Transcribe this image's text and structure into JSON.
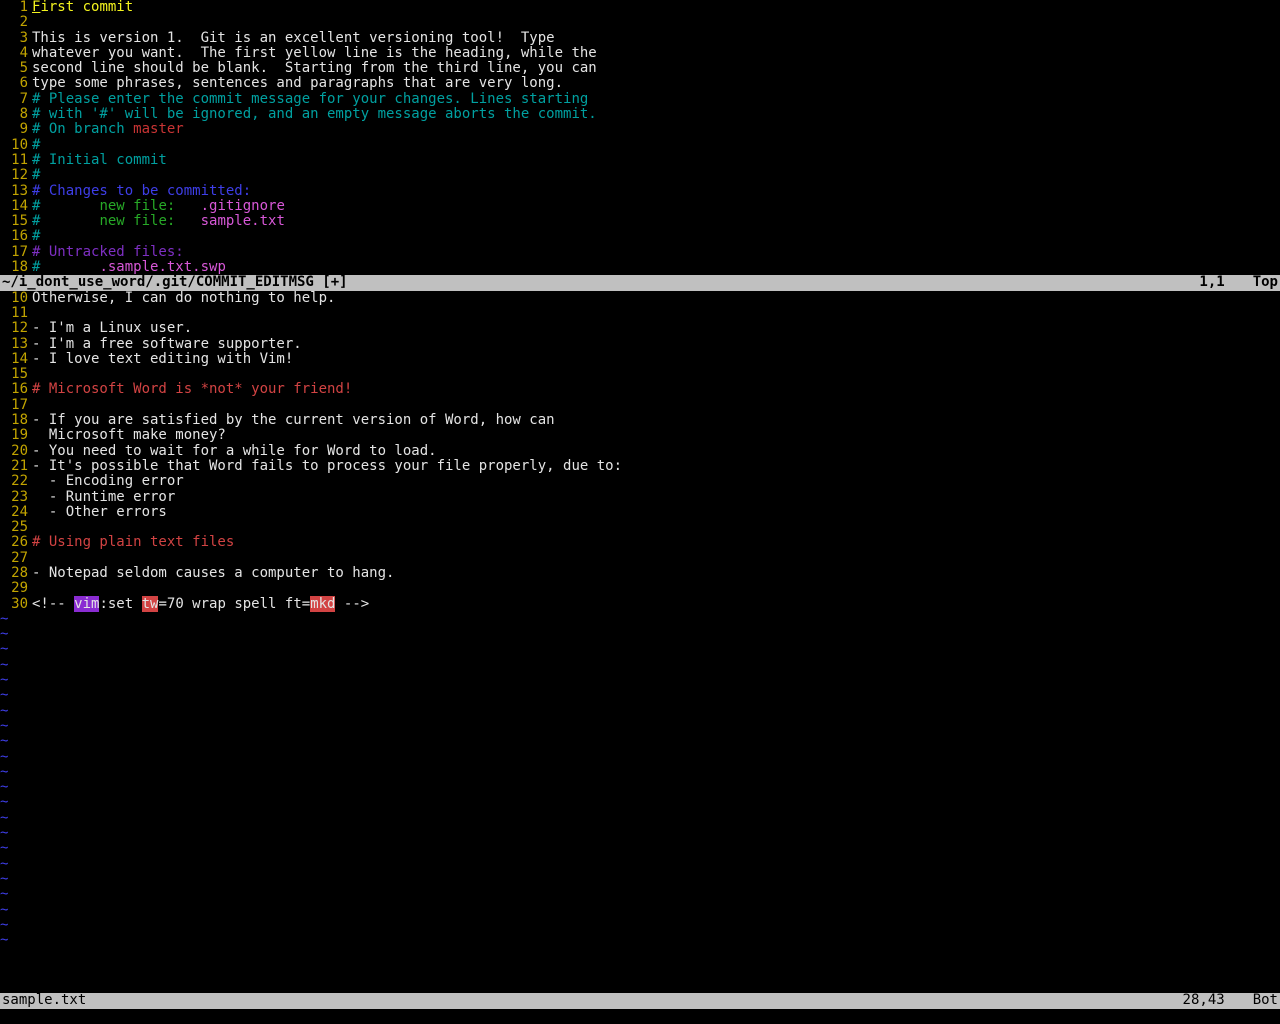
{
  "top_lines": [
    {
      "n": 1,
      "spans": [
        {
          "cls": "c-yellow cursor",
          "t": "F"
        },
        {
          "cls": "c-yellow",
          "t": "irst commit"
        }
      ]
    },
    {
      "n": 2,
      "spans": []
    },
    {
      "n": 3,
      "spans": [
        {
          "cls": "c-white",
          "t": "This is version 1.  Git is an excellent versioning tool!  Type"
        }
      ]
    },
    {
      "n": 4,
      "spans": [
        {
          "cls": "c-white",
          "t": "whatever you want.  The first yellow line is the heading, while the"
        }
      ]
    },
    {
      "n": 5,
      "spans": [
        {
          "cls": "c-white",
          "t": "second line should be blank.  Starting from the third line, you can"
        }
      ]
    },
    {
      "n": 6,
      "spans": [
        {
          "cls": "c-white",
          "t": "type some phrases, sentences and paragraphs that are very long."
        }
      ]
    },
    {
      "n": 7,
      "spans": [
        {
          "cls": "c-cyan",
          "t": "# Please enter the commit message for your changes. Lines starting"
        }
      ]
    },
    {
      "n": 8,
      "spans": [
        {
          "cls": "c-cyan",
          "t": "# with '#' will be ignored, and an empty message aborts the commit."
        }
      ]
    },
    {
      "n": 9,
      "spans": [
        {
          "cls": "c-cyan",
          "t": "# On branch "
        },
        {
          "cls": "c-red",
          "t": "master"
        }
      ]
    },
    {
      "n": 10,
      "spans": [
        {
          "cls": "c-cyan",
          "t": "#"
        }
      ]
    },
    {
      "n": 11,
      "spans": [
        {
          "cls": "c-cyan",
          "t": "# Initial commit"
        }
      ]
    },
    {
      "n": 12,
      "spans": [
        {
          "cls": "c-cyan",
          "t": "#"
        }
      ]
    },
    {
      "n": 13,
      "spans": [
        {
          "cls": "c-blue",
          "t": "# Changes to be committed:"
        }
      ]
    },
    {
      "n": 14,
      "spans": [
        {
          "cls": "c-cyan",
          "t": "#       "
        },
        {
          "cls": "c-green",
          "t": "new file:   "
        },
        {
          "cls": "c-magenta",
          "t": ".gitignore"
        }
      ]
    },
    {
      "n": 15,
      "spans": [
        {
          "cls": "c-cyan",
          "t": "#       "
        },
        {
          "cls": "c-green",
          "t": "new file:   "
        },
        {
          "cls": "c-magenta",
          "t": "sample.txt"
        }
      ]
    },
    {
      "n": 16,
      "spans": [
        {
          "cls": "c-cyan",
          "t": "#"
        }
      ]
    },
    {
      "n": 17,
      "spans": [
        {
          "cls": "c-purple",
          "t": "# Untracked files:"
        }
      ]
    },
    {
      "n": 18,
      "spans": [
        {
          "cls": "c-cyan",
          "t": "#       "
        },
        {
          "cls": "c-magenta",
          "t": ".sample.txt.swp"
        }
      ]
    }
  ],
  "top_status": {
    "left": "~/i_dont_use_word/.git/COMMIT_EDITMSG [+]",
    "mid": "1,1",
    "right": "Top"
  },
  "bottom_lines": [
    {
      "n": 10,
      "spans": [
        {
          "cls": "c-white",
          "t": "Otherwise, I can do nothing to help."
        }
      ]
    },
    {
      "n": 11,
      "spans": []
    },
    {
      "n": 12,
      "spans": [
        {
          "cls": "c-white",
          "t": "- I'm a Linux user."
        }
      ]
    },
    {
      "n": 13,
      "spans": [
        {
          "cls": "c-white",
          "t": "- I'm a free software supporter."
        }
      ]
    },
    {
      "n": 14,
      "spans": [
        {
          "cls": "c-white",
          "t": "- I love text editing with Vim!"
        }
      ]
    },
    {
      "n": 15,
      "spans": []
    },
    {
      "n": 16,
      "spans": [
        {
          "cls": "c-markhead",
          "t": "# Microsoft Word is *not* your friend!"
        }
      ]
    },
    {
      "n": 17,
      "spans": []
    },
    {
      "n": 18,
      "spans": [
        {
          "cls": "c-white",
          "t": "- If you are satisfied by the current version of Word, how can"
        }
      ]
    },
    {
      "n": 19,
      "spans": [
        {
          "cls": "c-white",
          "t": "  Microsoft make money?"
        }
      ]
    },
    {
      "n": 20,
      "spans": [
        {
          "cls": "c-white",
          "t": "- You need to wait for a while for Word to load."
        }
      ]
    },
    {
      "n": 21,
      "spans": [
        {
          "cls": "c-white",
          "t": "- It's possible that Word fails to process your file properly, due to:"
        }
      ]
    },
    {
      "n": 22,
      "spans": [
        {
          "cls": "c-white",
          "t": "  - Encoding error"
        }
      ]
    },
    {
      "n": 23,
      "spans": [
        {
          "cls": "c-white",
          "t": "  - Runtime error"
        }
      ]
    },
    {
      "n": 24,
      "spans": [
        {
          "cls": "c-white",
          "t": "  - Other errors"
        }
      ]
    },
    {
      "n": 25,
      "spans": []
    },
    {
      "n": 26,
      "spans": [
        {
          "cls": "c-markhead",
          "t": "# Using plain text files"
        }
      ]
    },
    {
      "n": 27,
      "spans": []
    },
    {
      "n": 28,
      "spans": [
        {
          "cls": "c-white",
          "t": "- Notepad seldom causes a computer to hang."
        }
      ]
    },
    {
      "n": 29,
      "spans": []
    },
    {
      "n": 30,
      "spans": [
        {
          "cls": "c-white",
          "t": "<!-- "
        },
        {
          "cls": "hl-purple",
          "t": "vim"
        },
        {
          "cls": "c-white",
          "t": ":set "
        },
        {
          "cls": "hl-red",
          "t": "tw"
        },
        {
          "cls": "c-white",
          "t": "=70 wrap spell ft="
        },
        {
          "cls": "hl-red",
          "t": "mkd"
        },
        {
          "cls": "c-white",
          "t": " -->"
        }
      ]
    }
  ],
  "tilde_count": 22,
  "bottom_status": {
    "left": "sample.txt",
    "mid": "28,43",
    "right": "Bot"
  },
  "cmdline": ""
}
